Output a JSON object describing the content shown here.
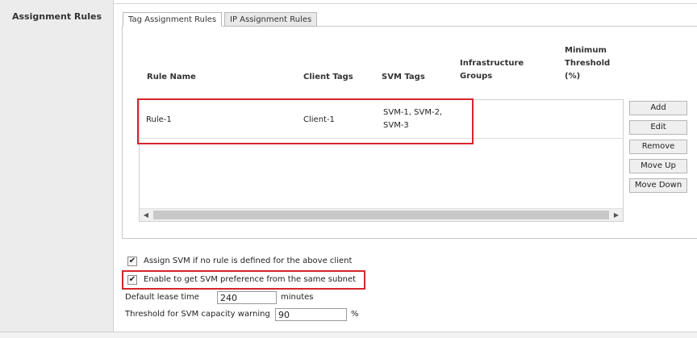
{
  "section": {
    "label": "Assignment Rules"
  },
  "tabs": [
    {
      "label": "Tag Assignment Rules"
    },
    {
      "label": "IP Assignment Rules"
    }
  ],
  "columns": {
    "rule_name": "Rule Name",
    "client_tags": "Client Tags",
    "svm_tags": "SVM Tags",
    "infra_line1": "Infrastructure",
    "infra_line2": "Groups",
    "min_line1": "Minimum",
    "min_line2": "Threshold",
    "min_line3": "(%)"
  },
  "rows": [
    {
      "rule_name": "Rule-1",
      "client_tags": "Client-1",
      "svm_tags_line1": "SVM-1, SVM-2,",
      "svm_tags_line2": "SVM-3",
      "infrastructure_groups": "",
      "minimum_threshold": ""
    }
  ],
  "buttons": {
    "add": "Add",
    "edit": "Edit",
    "remove": "Remove",
    "move_up": "Move Up",
    "move_down": "Move Down"
  },
  "options": {
    "assign_svm_label": "Assign SVM if no rule is defined for the above client",
    "assign_svm_checked": true,
    "enable_subnet_label": "Enable to get SVM preference from the same subnet",
    "enable_subnet_checked": true
  },
  "lease": {
    "label": "Default lease time",
    "value": "240",
    "unit": "minutes"
  },
  "threshold": {
    "label": "Threshold for SVM capacity warning",
    "value": "90",
    "unit": "%"
  },
  "colors": {
    "highlight": "#d6252b"
  }
}
